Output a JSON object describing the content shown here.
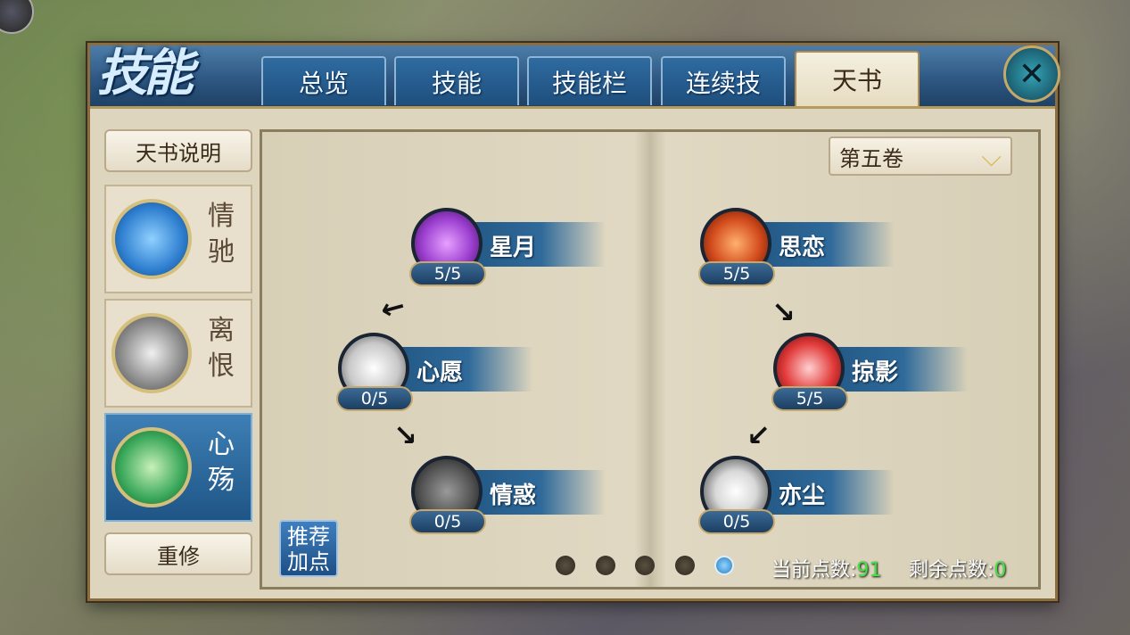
{
  "header": {
    "title": "技能",
    "tabs": [
      {
        "label": "总览",
        "active": false
      },
      {
        "label": "技能",
        "active": false
      },
      {
        "label": "技能栏",
        "active": false
      },
      {
        "label": "连续技",
        "active": false
      },
      {
        "label": "天书",
        "active": true
      }
    ],
    "close_icon": "close-icon"
  },
  "sidebar": {
    "help_label": "天书说明",
    "schools": [
      {
        "name": "情驰",
        "active": false,
        "color": "#2f7fd0"
      },
      {
        "name": "离恨",
        "active": false,
        "color": "#8a8a8a"
      },
      {
        "name": "心殇",
        "active": true,
        "color": "#3aa85a"
      }
    ],
    "reset_label": "重修"
  },
  "book": {
    "volume_selected": "第五卷",
    "skills": [
      {
        "name": "星月",
        "level": "5/5",
        "color": "#9c3fd0"
      },
      {
        "name": "心愿",
        "level": "0/5",
        "color": "#c8c8c8"
      },
      {
        "name": "情惑",
        "level": "0/5",
        "color": "#555555"
      },
      {
        "name": "思恋",
        "level": "5/5",
        "color": "#d24a1c"
      },
      {
        "name": "掠影",
        "level": "5/5",
        "color": "#e23a3a"
      },
      {
        "name": "亦尘",
        "level": "0/5",
        "color": "#d8d8d8"
      }
    ],
    "recommend_label": "推荐加点",
    "page_count": 5,
    "page_active": 5
  },
  "points": {
    "current_label": "当前点数:",
    "current_value": "91",
    "remaining_label": "剩余点数:",
    "remaining_value": "0"
  }
}
